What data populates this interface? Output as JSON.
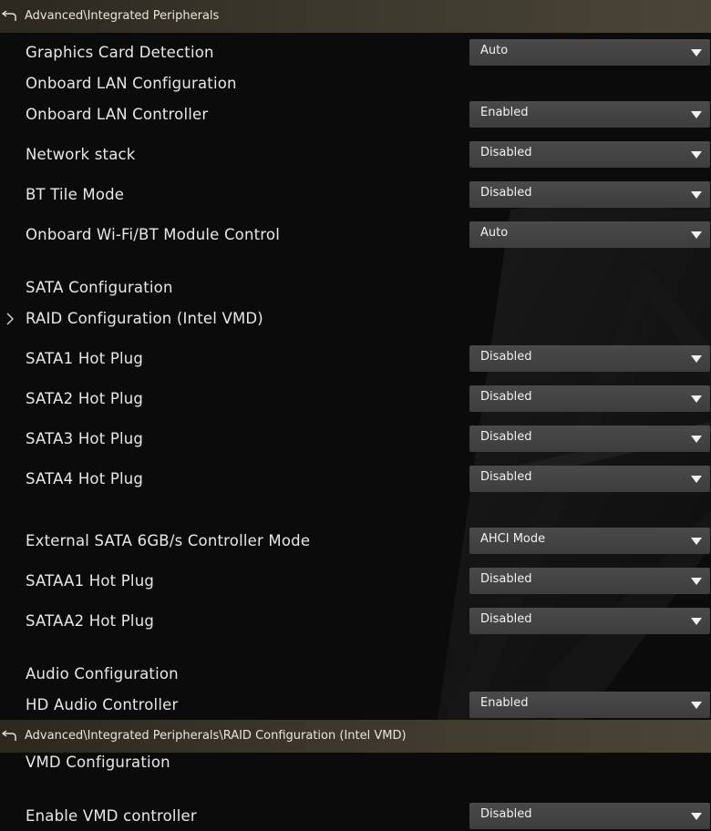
{
  "header1": {
    "path": "Advanced\\Integrated Peripherals"
  },
  "rows1": [
    {
      "label": "Graphics Card Detection",
      "value": "Auto"
    },
    {
      "label": "Onboard LAN Configuration"
    },
    {
      "label": "Onboard LAN Controller",
      "value": "Enabled"
    },
    {
      "label": "Network stack",
      "value": "Disabled"
    },
    {
      "label": "BT Tile Mode",
      "value": "Disabled"
    },
    {
      "label": "Onboard Wi-Fi/BT Module Control",
      "value": "Auto"
    },
    {
      "label": "SATA Configuration"
    },
    {
      "label": "RAID Configuration (Intel VMD)"
    },
    {
      "label": "SATA1 Hot Plug",
      "value": "Disabled"
    },
    {
      "label": "SATA2 Hot Plug",
      "value": "Disabled"
    },
    {
      "label": "SATA3 Hot Plug",
      "value": "Disabled"
    },
    {
      "label": "SATA4 Hot Plug",
      "value": "Disabled"
    },
    {
      "label": "External SATA 6GB/s Controller Mode",
      "value": "AHCI Mode"
    },
    {
      "label": "SATAA1 Hot Plug",
      "value": "Disabled"
    },
    {
      "label": "SATAA2 Hot Plug",
      "value": "Disabled"
    },
    {
      "label": "Audio Configuration"
    },
    {
      "label": "HD Audio Controller",
      "value": "Enabled"
    }
  ],
  "header2": {
    "path": "Advanced\\Integrated Peripherals\\RAID Configuration (Intel VMD)"
  },
  "rows2": [
    {
      "label": "VMD Configuration"
    },
    {
      "label": "Enable VMD controller",
      "value": "Disabled"
    }
  ]
}
